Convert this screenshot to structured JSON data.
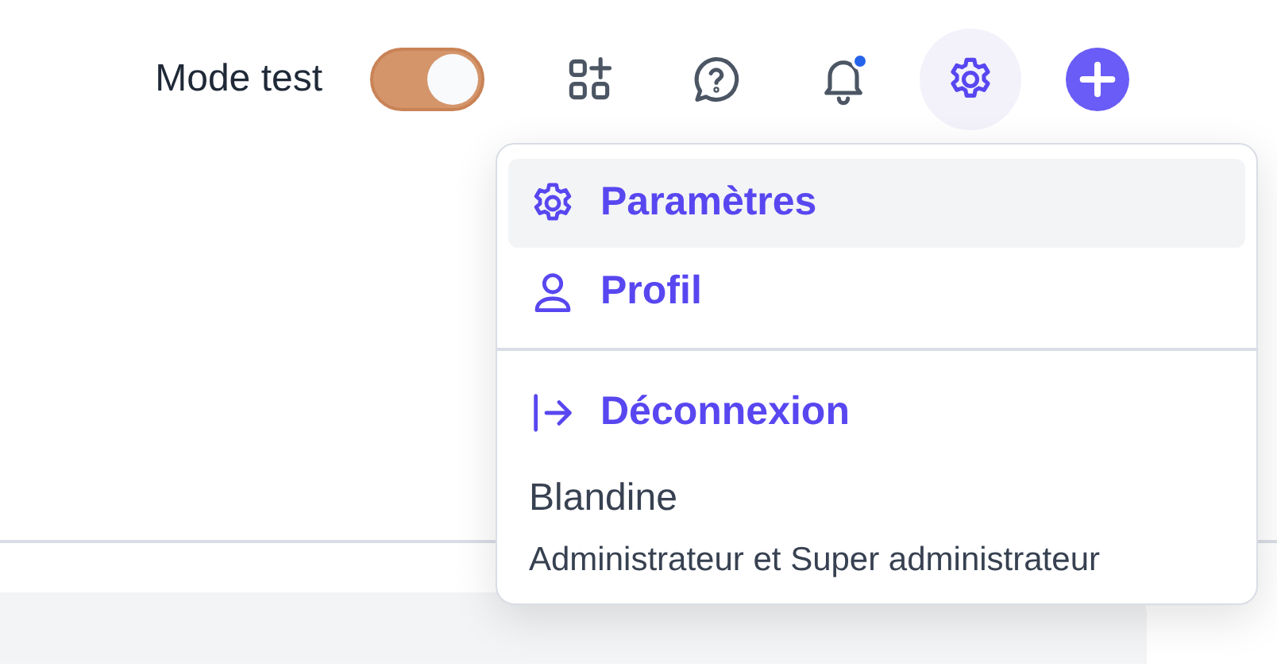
{
  "header": {
    "mode_test": {
      "label": "Mode test",
      "on": true
    },
    "tools": [
      {
        "kind": "apps",
        "selected": false,
        "badge": false
      },
      {
        "kind": "help",
        "selected": false,
        "badge": false
      },
      {
        "kind": "bell",
        "selected": false,
        "badge": true
      },
      {
        "kind": "gear",
        "selected": true,
        "badge": false
      },
      {
        "kind": "add",
        "selected": false,
        "badge": false
      }
    ]
  },
  "settings_menu": {
    "items": [
      {
        "kind": "gear",
        "label": "Paramètres",
        "selected": true
      },
      {
        "kind": "person",
        "label": "Profil",
        "selected": false
      },
      {
        "kind": "logout",
        "label": "Déconnexion",
        "selected": false
      }
    ],
    "user": {
      "name": "Blandine",
      "role": "Administrateur et Super administrateur"
    }
  }
}
